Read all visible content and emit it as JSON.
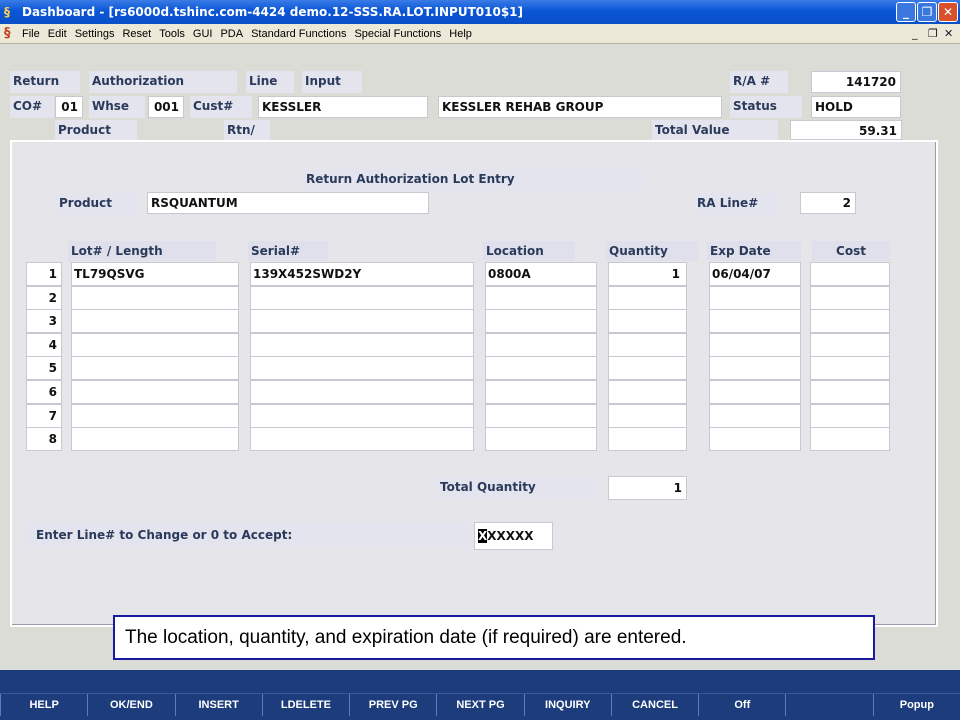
{
  "window": {
    "title": "Dashboard - [rs6000d.tshinc.com-4424 demo.12-SSS.RA.LOT.INPUT010$1]",
    "minimize_label": "_",
    "restore_label": "❐",
    "close_label": "✕"
  },
  "menu": [
    "File",
    "Edit",
    "Settings",
    "Reset",
    "Tools",
    "GUI",
    "PDA",
    "Standard Functions",
    "Special Functions",
    "Help"
  ],
  "header": {
    "return_label": "Return",
    "authorization_label": "Authorization",
    "line_label": "Line",
    "input_label": "Input",
    "ra_label": "R/A #",
    "ra_value": "141720",
    "co_label": "CO#",
    "co_value": "01",
    "whse_label": "Whse",
    "whse_value": "001",
    "cust_label": "Cust#",
    "cust_value": "KESSLER",
    "cust_name": "KESSLER REHAB GROUP",
    "status_label": "Status",
    "status_value": "HOLD",
    "product_label": "Product",
    "rtn_label": "Rtn/",
    "total_value_label": "Total Value",
    "total_value": "59.31"
  },
  "form": {
    "title": "Return Authorization Lot Entry",
    "product_label": "Product",
    "product_value": "RSQUANTUM",
    "ra_line_label": "RA Line#",
    "ra_line_value": "2",
    "columns": [
      "Lot# / Length",
      "Serial#",
      "Location",
      "Quantity",
      "Exp Date",
      "Cost"
    ],
    "rows": [
      {
        "num": "1",
        "lot": "TL79QSVG",
        "serial": "139X452SWD2Y",
        "location": "0800A",
        "quantity": "1",
        "exp": "06/04/07",
        "cost": ""
      },
      {
        "num": "2",
        "lot": "",
        "serial": "",
        "location": "",
        "quantity": "",
        "exp": "",
        "cost": ""
      },
      {
        "num": "3",
        "lot": "",
        "serial": "",
        "location": "",
        "quantity": "",
        "exp": "",
        "cost": ""
      },
      {
        "num": "4",
        "lot": "",
        "serial": "",
        "location": "",
        "quantity": "",
        "exp": "",
        "cost": ""
      },
      {
        "num": "5",
        "lot": "",
        "serial": "",
        "location": "",
        "quantity": "",
        "exp": "",
        "cost": ""
      },
      {
        "num": "6",
        "lot": "",
        "serial": "",
        "location": "",
        "quantity": "",
        "exp": "",
        "cost": ""
      },
      {
        "num": "7",
        "lot": "",
        "serial": "",
        "location": "",
        "quantity": "",
        "exp": "",
        "cost": ""
      },
      {
        "num": "8",
        "lot": "",
        "serial": "",
        "location": "",
        "quantity": "",
        "exp": "",
        "cost": ""
      }
    ],
    "total_quantity_label": "Total Quantity",
    "total_quantity_value": "1",
    "prompt_label": "Enter Line# to Change or 0 to Accept:",
    "prompt_cursor": "X",
    "prompt_value": "XXXXX"
  },
  "callout": "The location, quantity, and expiration date (if required) are entered.",
  "function_keys": [
    "HELP",
    "OK/END",
    "INSERT",
    "LDELETE",
    "PREV PG",
    "NEXT PG",
    "INQUIRY",
    "CANCEL",
    "Off",
    "",
    "Popup"
  ]
}
